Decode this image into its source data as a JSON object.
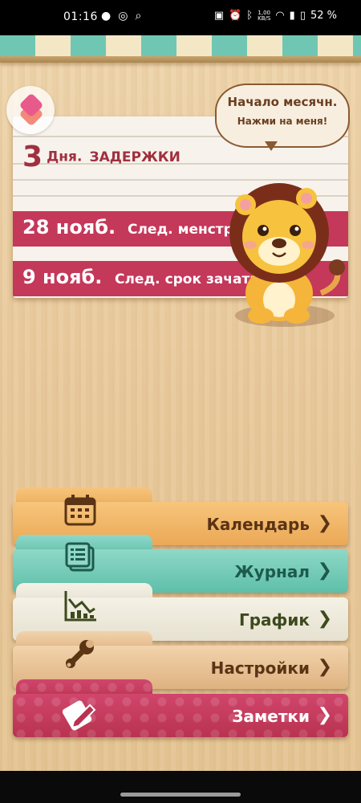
{
  "status_bar": {
    "time": "01:16",
    "left_icons": [
      "chat-icon",
      "whatsapp-icon",
      "search-icon"
    ],
    "net_speed": "1,00",
    "net_unit": "KB/S",
    "battery": "52 %"
  },
  "speech_bubble": {
    "title": "Начало месячн.",
    "subtitle": "Нажми на меня!"
  },
  "summary": {
    "delay_days": "3",
    "delay_unit": "Дня.",
    "delay_text": "ЗАДЕРЖКИ",
    "next_date": "28 нояб.",
    "next_label": "След. менструация",
    "fertile_date": "9 нояб.",
    "fertile_label": "След. срок зачатия"
  },
  "menu": {
    "calendar": "Календарь",
    "journal": "Журнал",
    "graph": "График",
    "settings": "Настройки",
    "notes": "Заметки",
    "chevron": "❯"
  },
  "colors": {
    "accent_red": "#c4385a",
    "calendar": "#eba856",
    "journal": "#5dbfa9",
    "graph": "#e6e1d0",
    "settings": "#deb280",
    "notes": "#b9324f"
  }
}
